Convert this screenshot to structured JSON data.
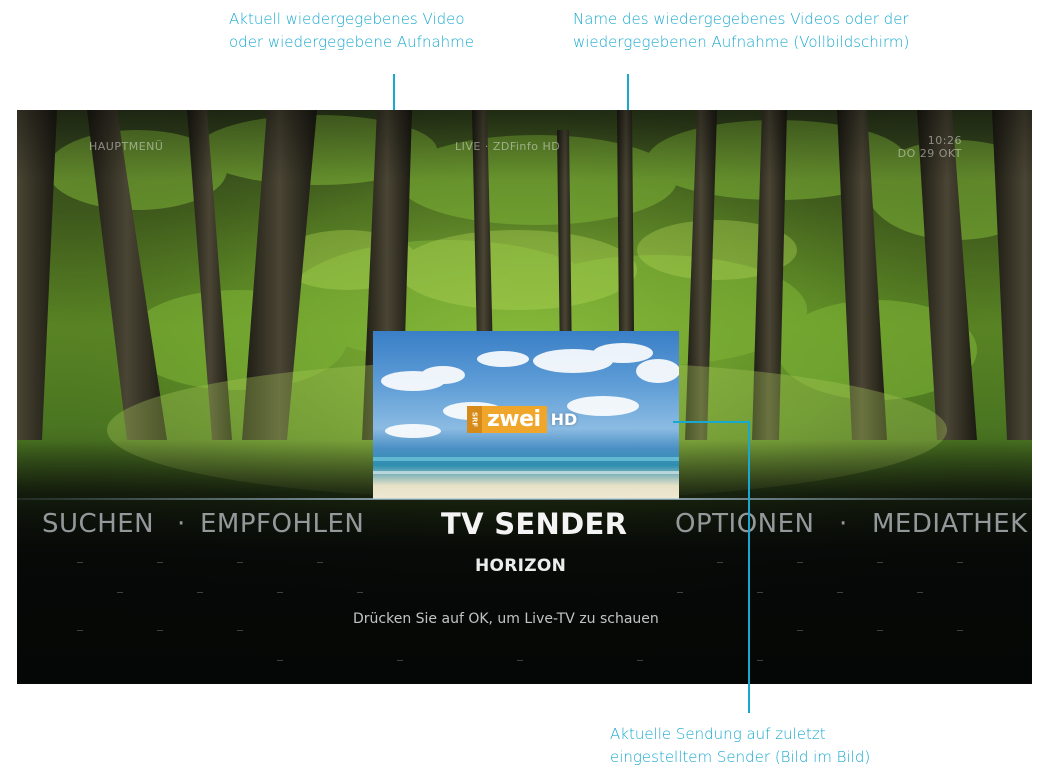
{
  "callouts": {
    "current_video": [
      "Aktuell wiedergegebenes Video",
      "oder wiedergegebene Aufnahme"
    ],
    "video_name": [
      "Name des wiedergegebenes Videos oder der",
      "wiedergegebenen Aufnahme (Vollbildschirm)"
    ],
    "pip_program": [
      "Aktuelle Sendung auf zuletzt",
      "eingestelltem Sender (Bild im Bild)"
    ]
  },
  "screen": {
    "hud": {
      "main_menu": "HAUPTMENÜ",
      "now_playing": "LIVE · ZDFinfo HD",
      "time": "10:26",
      "date": "DO 29 OKT"
    },
    "pip": {
      "channel_logo": {
        "prefix": "SRF",
        "name": "zwei",
        "suffix": "HD"
      }
    },
    "menu": {
      "items_left": [
        "SUCHEN",
        "EMPFOHLEN"
      ],
      "active": "TV SENDER",
      "items_right": [
        "OPTIONEN",
        "MEDIATHEK"
      ],
      "separator": "·",
      "subtitle": "HORIZON",
      "hint": "Drücken Sie auf OK, um Live-TV zu schauen"
    }
  },
  "colors": {
    "callout": "#19a9d0",
    "logo_orange": "#f0a62a"
  }
}
